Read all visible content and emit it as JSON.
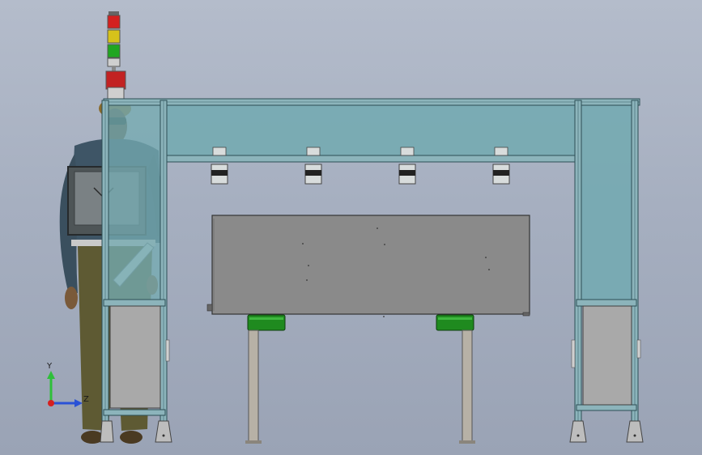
{
  "viewport": {
    "background_top": "#b4bccb",
    "background_bottom": "#9aa3b5"
  },
  "triad": {
    "y_axis_label": "Y",
    "z_axis_label": "Z",
    "y_axis_color": "#2fbf3a",
    "z_axis_color": "#2a52d6",
    "origin_color": "#d62020"
  },
  "model": {
    "frame_glass_color": "#74aab1",
    "frame_edge_color": "#2d4e55",
    "cabinet_color": "#a9a9a9",
    "table_top_color": "#8a8a8a",
    "table_foot_color": "#1f8a1f",
    "signal_tower_colors": [
      "#d42020",
      "#d6c21a",
      "#21a621"
    ],
    "icons": [
      "signal-tower-icon",
      "human-figure-icon",
      "coordinate-triad-icon"
    ]
  }
}
